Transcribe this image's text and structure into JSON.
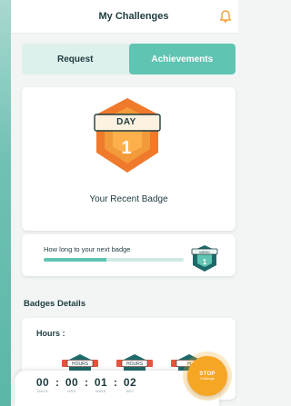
{
  "header": {
    "title": "My Challenges",
    "bell_icon": "bell-icon"
  },
  "tabs": [
    {
      "label": "Request",
      "active": false
    },
    {
      "label": "Achievements",
      "active": true
    }
  ],
  "recent_badge": {
    "label": "DAY",
    "number": "1",
    "caption": "Your Recent Badge",
    "colors": {
      "outer": "#f07a2c",
      "inner": "#f39a3a",
      "banner": "#fdf2e0"
    }
  },
  "next_badge": {
    "label": "How long to your next badge",
    "progress": 0.45,
    "mini_badge_label": "WEEK",
    "mini_badge_number": "1"
  },
  "badges_details": {
    "title": "Badges Details",
    "hours_label": "Hours :",
    "hour_badges": [
      {
        "label": "HOURS"
      },
      {
        "label": "HOURS"
      },
      {
        "label": "H"
      }
    ]
  },
  "timer": {
    "days": "00",
    "hrs": "00",
    "mins": "01",
    "sec": "02",
    "units": {
      "days": "DAYS",
      "hrs": "HRS",
      "mins": "MINS",
      "sec": "SEC"
    }
  },
  "stop_button": {
    "label": "STOP",
    "sub": "Challenge"
  },
  "colors": {
    "accent": "#5fc4b1",
    "accent_light": "#ddf0ec",
    "stop": "#f5a623",
    "text": "#1e3b3f"
  }
}
